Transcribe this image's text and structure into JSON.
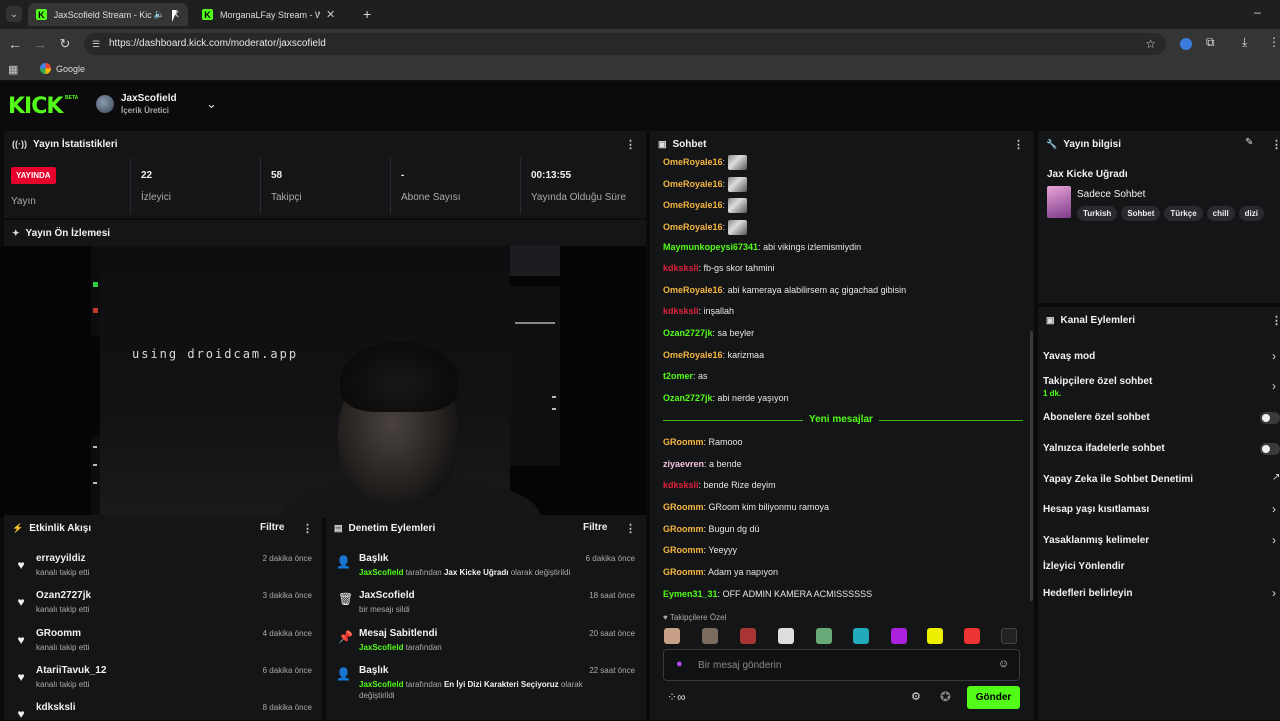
{
  "browser": {
    "tabs": [
      {
        "title": "JaxScofield Stream - Kick Da",
        "active": true
      },
      {
        "title": "MorganaLFay Stream - Watch L",
        "active": false
      }
    ],
    "url": "https://dashboard.kick.com/moderator/jaxscofield",
    "bookmark": "Google"
  },
  "header": {
    "logo": "KICK",
    "beta": "BETA",
    "username": "JaxScofield",
    "role": "İçerik Üretici"
  },
  "stats": {
    "title": "Yayın İstatistikleri",
    "live_badge": "YAYINDA",
    "live_label": "Yayın",
    "viewers": "22",
    "viewers_label": "İzleyici",
    "followers": "58",
    "followers_label": "Takipçi",
    "subs": "-",
    "subs_label": "Abone Sayısı",
    "uptime": "00:13:55",
    "uptime_label": "Yayında Olduğu Süre"
  },
  "preview": {
    "title": "Yayın Ön İzlemesi",
    "overlay_text": "using droidcam.app"
  },
  "activity": {
    "title": "Etkinlik Akışı",
    "filter": "Filtre",
    "items": [
      {
        "name": "errayyildiz",
        "sub": "kanalı takip etti",
        "time": "2 dakika önce"
      },
      {
        "name": "Ozan2727jk",
        "sub": "kanalı takip etti",
        "time": "3 dakika önce"
      },
      {
        "name": "GRoomm",
        "sub": "kanalı takip etti",
        "time": "4 dakika önce"
      },
      {
        "name": "AtariiTavuk_12",
        "sub": "kanalı takip etti",
        "time": "6 dakika önce"
      },
      {
        "name": "kdksksli",
        "sub": "",
        "time": "8 dakika önce"
      }
    ]
  },
  "moderation": {
    "title": "Denetim Eylemleri",
    "filter": "Filtre",
    "items": [
      {
        "title": "Başlık",
        "user": "JaxScofield",
        "mid": "tarafından",
        "bold": "Jax Kicke Uğradı",
        "rest": "olarak değiştirildi",
        "time": "6 dakika önce"
      },
      {
        "title": "JaxScofield",
        "user": "",
        "mid": "bir mesajı sildi",
        "bold": "",
        "rest": "",
        "time": "18 saat önce"
      },
      {
        "title": "Mesaj Sabitlendi",
        "user": "JaxScofield",
        "mid": "tarafından",
        "bold": "",
        "rest": "",
        "time": "20 saat önce"
      },
      {
        "title": "Başlık",
        "user": "JaxScofield",
        "mid": "tarafından",
        "bold": "En İyi Dizi Karakteri Seçiyoruz",
        "rest": "olarak",
        "rest2": "değiştirildi",
        "time": "22 saat önce"
      }
    ]
  },
  "chat": {
    "title": "Sohbet",
    "messages": [
      {
        "user": "OmeRoyale16",
        "text": "",
        "color": "#f5b642",
        "emote": true
      },
      {
        "user": "OmeRoyale16",
        "text": "",
        "color": "#f5b642",
        "emote": true
      },
      {
        "user": "OmeRoyale16",
        "text": "",
        "color": "#f5b642",
        "emote": true
      },
      {
        "user": "OmeRoyale16",
        "text": "",
        "color": "#f5b642",
        "emote": true
      },
      {
        "user": "Maymunkopeysi67341",
        "text": "abi vikings izlemismiydin",
        "color": "#53fc18"
      },
      {
        "user": "kdksksli",
        "text": "fb-gs skor tahmini",
        "color": "#e0223c"
      },
      {
        "user": "OmeRoyale16",
        "text": "abi kameraya alabilirsem aç gigachad gibisin",
        "color": "#f5b642"
      },
      {
        "user": "kdksksli",
        "text": "inşallah",
        "color": "#e0223c"
      },
      {
        "user": "Ozan2727jk",
        "text": "sa beyler",
        "color": "#53fc18"
      },
      {
        "user": "OmeRoyale16",
        "text": "karizmaa",
        "color": "#f5b642"
      },
      {
        "user": "t2omer",
        "text": "as",
        "color": "#53fc18"
      },
      {
        "user": "Ozan2727jk",
        "text": "abi nerde yaşıyon",
        "color": "#53fc18"
      }
    ],
    "new_messages": "Yeni mesajlar",
    "messages2": [
      {
        "user": "GRoomm",
        "text": "Ramooo",
        "color": "#f5b642"
      },
      {
        "user": "ziyaevren",
        "text": "a bende",
        "color": "#f5c2e0"
      },
      {
        "user": "kdksksli",
        "text": "bende Rize deyim",
        "color": "#e0223c"
      },
      {
        "user": "GRoomm",
        "text": "GRoom kim biliyonmu ramoya",
        "color": "#f5b642"
      },
      {
        "user": "GRoomm",
        "text": "Bugun dg dü",
        "color": "#f5b642"
      },
      {
        "user": "GRoomm",
        "text": "Yeeyyy",
        "color": "#f5b642"
      },
      {
        "user": "GRoomm",
        "text": "Adam ya napıyon",
        "color": "#f5b642"
      },
      {
        "user": "Eymen31_31",
        "text": "OFF ADMIN KAMERA ACMISSSSSS",
        "color": "#53fc18"
      }
    ],
    "followers_only": "Takipçilere Özel",
    "input_placeholder": "Bir mesaj gönderin",
    "send": "Gönder"
  },
  "stream_info": {
    "title": "Yayın bilgisi",
    "stream_title": "Jax Kicke Uğradı",
    "category": "Sadece Sohbet",
    "tags": [
      "Turkish",
      "Sohbet",
      "Türkçe",
      "chill",
      "dizi"
    ]
  },
  "channel_actions": {
    "title": "Kanal Eylemleri",
    "slow_mode": "Yavaş mod",
    "followers_chat": "Takipçilere özel sohbet",
    "followers_chat_value": "1 dk.",
    "subs_chat": "Abonelere özel sohbet",
    "emotes_chat": "Yalnızca ifadelerle sohbet",
    "ai_moderation": "Yapay Zeka ile Sohbet Denetimi",
    "age_restrictions": "Hesap yaşı kısıtlaması",
    "banned_words": "Yasaklanmış kelimeler",
    "raid": "İzleyici Yönlendir",
    "goals": "Hedefleri belirleyin"
  }
}
